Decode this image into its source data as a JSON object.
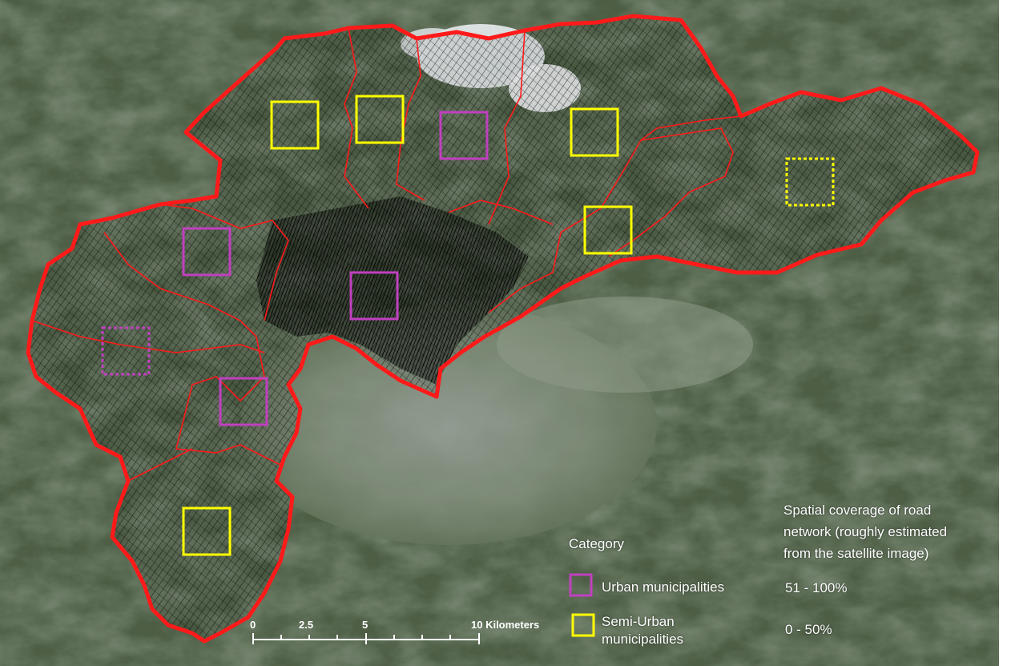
{
  "legend": {
    "title": "Category",
    "items": [
      {
        "label": "Urban municipalities",
        "color": "#c040c0"
      },
      {
        "label": "Semi-Urban municipalities",
        "color": "#ffff00"
      }
    ]
  },
  "coverage": {
    "title": "Spatial coverage of road network (roughly estimated from the satellite image)",
    "title_lines": [
      "Spatial coverage of road",
      "network (roughly estimated",
      "from the satellite image)"
    ],
    "items": [
      {
        "label": "51 - 100%",
        "line": "solid"
      },
      {
        "label": "0 - 50%",
        "line": "dotted"
      }
    ]
  },
  "scale_bar": {
    "labels": [
      "0",
      "2.5",
      "5",
      "10 Kilometers"
    ]
  },
  "colors": {
    "boundary": "#ff1a1a",
    "roads": "#000000",
    "urban": "#c040c0",
    "semi_urban": "#ffff00",
    "terrain": "#4a5a40",
    "valley": "#8a948a"
  }
}
